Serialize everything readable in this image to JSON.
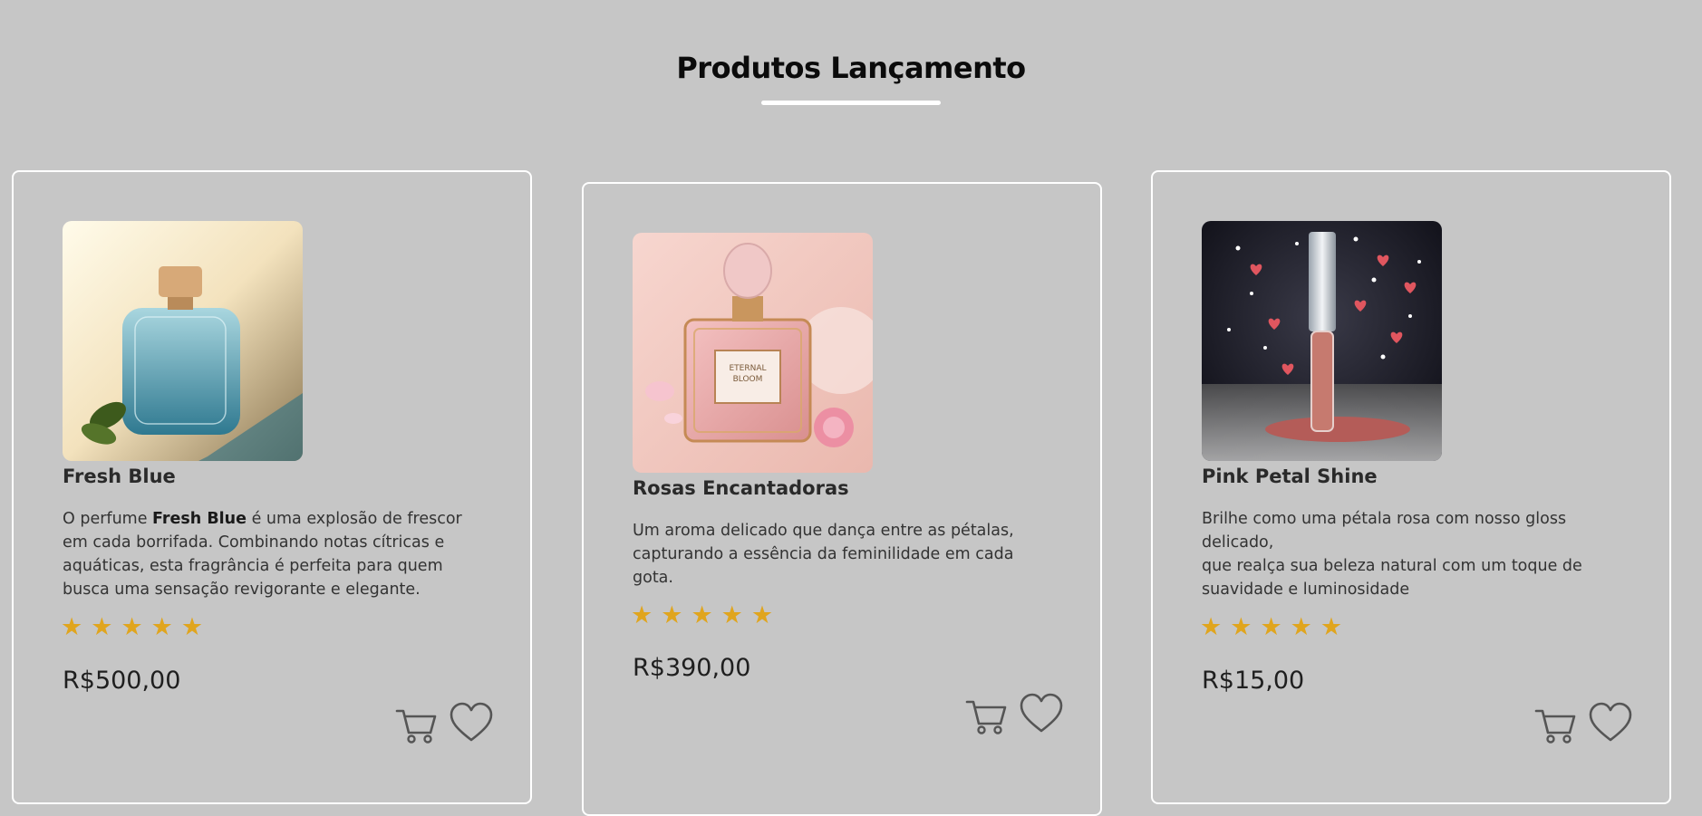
{
  "section": {
    "title": "Produtos Lançamento"
  },
  "products": [
    {
      "name": "Fresh Blue",
      "desc_prefix": "O perfume ",
      "desc_bold": "Fresh Blue",
      "desc_rest": " é uma explosão de frescor em cada borrifada. Combinando notas cítricas e aquáticas, esta fragrância é perfeita para quem busca uma sensação revigorante e elegante.",
      "rating": 5,
      "price": "R$500,00",
      "image": "blue-perfume-bottle"
    },
    {
      "name": "Rosas Encantadoras",
      "desc": "Um aroma delicado que dança entre as pétalas, capturando a essência da feminilidade em cada gota.",
      "rating": 5,
      "price": "R$390,00",
      "image": "pink-perfume-bottle",
      "label_line1": "ETERNAL",
      "label_line2": "BLOOM"
    },
    {
      "name": "Pink Petal Shine",
      "desc_line1": "Brilhe como uma pétala rosa com nosso gloss delicado,",
      "desc_line2": "que realça sua beleza natural com um toque de suavidade e luminosidade",
      "rating": 5,
      "price": "R$15,00",
      "image": "lip-gloss-with-hearts"
    }
  ],
  "icons": {
    "star": "★",
    "cart": "cart-icon",
    "heart": "heart-icon"
  },
  "colors": {
    "background": "#c6c6c6",
    "star": "#e0a51e",
    "card_border": "#ffffff"
  }
}
